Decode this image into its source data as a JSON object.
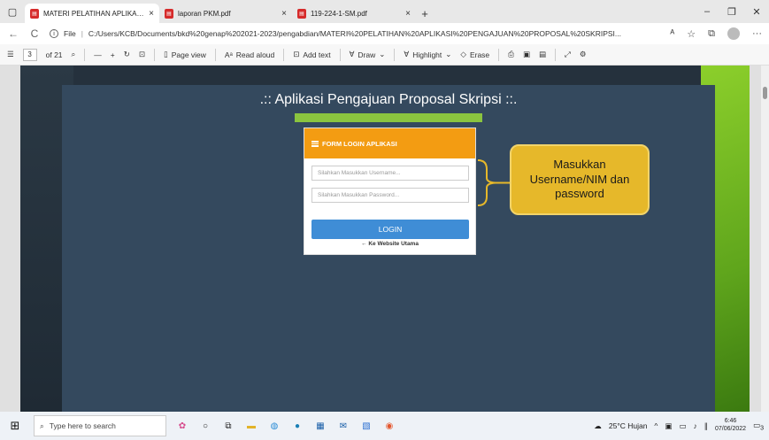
{
  "tabs": [
    {
      "title": "MATERI PELATIHAN APLIKASI PE",
      "close": "×",
      "active": true
    },
    {
      "title": "laporan PKM.pdf",
      "close": "×",
      "active": false
    },
    {
      "title": "119-224-1-SM.pdf",
      "close": "×",
      "active": false
    }
  ],
  "new_tab": "+",
  "window_controls": {
    "minimize": "–",
    "restore": "❐",
    "close": "✕"
  },
  "address": {
    "back": "←",
    "reload": "C",
    "file_label": "File",
    "url": "C:/Users/KCB/Documents/bkd%20genap%202021-2023/pengabdian/MATERI%20PELATIHAN%20APLIKASI%20PENGAJUAN%20PROPOSAL%20SKRIPSI...",
    "more": "···"
  },
  "pdf_toolbar": {
    "page_current": "3",
    "page_total": "of 21",
    "zoom_out": "—",
    "zoom_in": "+",
    "page_view": "Page view",
    "read_aloud": "Read aloud",
    "add_text": "Add text",
    "draw": "Draw",
    "highlight": "Highlight",
    "erase": "Erase"
  },
  "slide": {
    "app_title": ".:: Aplikasi Pengajuan Proposal Skripsi ::.",
    "form_title": "FORM LOGIN APLIKASI",
    "username_placeholder": "Silahkan Masukkan Username...",
    "password_placeholder": "Silahkan Masukkan Password...",
    "login_label": "LOGIN",
    "back_link": "Ke Website Utama",
    "callout": "Masukkan Username/NIM dan password"
  },
  "taskbar": {
    "search_placeholder": "Type here to search",
    "weather": "25°C Hujan",
    "time": "6:46",
    "date": "07/06/2022",
    "notification_count": "3"
  },
  "colors": {
    "slide_bg": "#34495e",
    "accent_orange": "#f39c12",
    "login_blue": "#3f8dd6",
    "callout_yellow": "#e6b82a",
    "green_bar": "#8bc43f"
  }
}
